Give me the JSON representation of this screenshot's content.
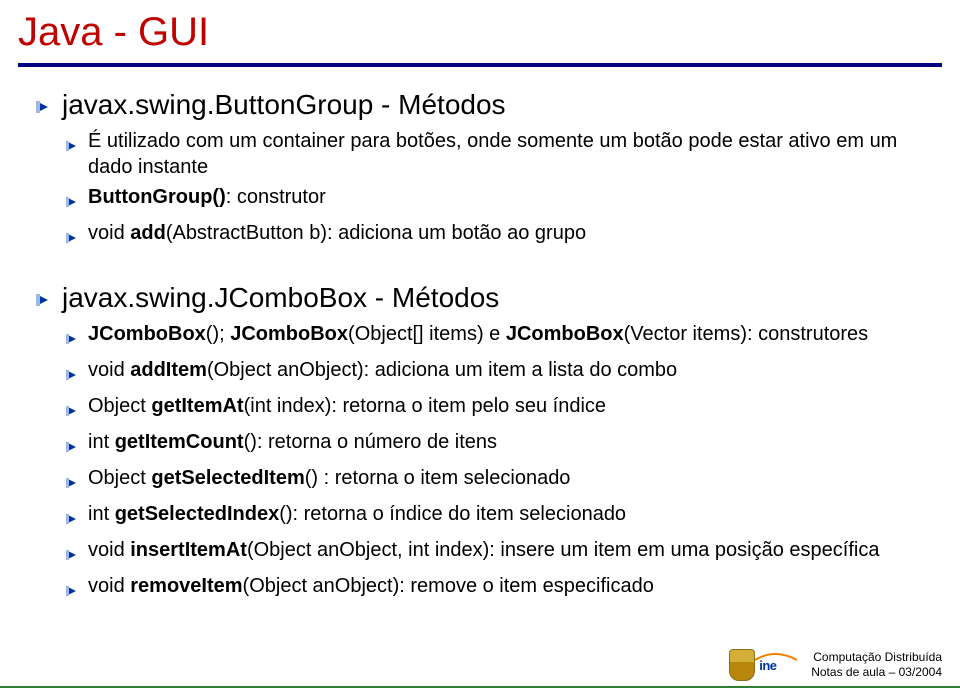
{
  "title": "Java - GUI",
  "section1": {
    "heading": "javax.swing.ButtonGroup - Métodos",
    "items": [
      {
        "text": "É utilizado com um container para botões, onde somente um botão pode estar ativo em um dado instante"
      },
      {
        "bold": "ButtonGroup()",
        "rest": ": construtor"
      },
      {
        "prefix": "void ",
        "bold": "add",
        "rest": "(AbstractButton b): adiciona um botão ao grupo"
      }
    ]
  },
  "section2": {
    "heading": "javax.swing.JComboBox - Métodos",
    "items": [
      {
        "bold": "JComboBox",
        "rest": "(); ",
        "bold2": "JComboBox",
        "rest2": "(Object[] items) e ",
        "bold3": "JComboBox",
        "rest3": "(Vector items): construtores"
      },
      {
        "prefix": "void ",
        "bold": "addItem",
        "rest": "(Object anObject): adiciona um item a lista do combo"
      },
      {
        "prefix": "Object ",
        "bold": "getItemAt",
        "rest": "(int index): retorna o item pelo seu índice"
      },
      {
        "prefix": "int ",
        "bold": "getItemCount",
        "rest": "(): retorna o número de itens"
      },
      {
        "prefix": "Object ",
        "bold": "getSelectedItem",
        "rest": "() : retorna o item selecionado"
      },
      {
        "prefix": " int ",
        "bold": "getSelectedIndex",
        "rest": "(): retorna o índice do item selecionado"
      },
      {
        "prefix": "void ",
        "bold": "insertItemAt",
        "rest": "(Object anObject, int index): insere um item em uma posição específica"
      },
      {
        "prefix": "void ",
        "bold": "removeItem",
        "rest": "(Object anObject): remove o item especificado"
      }
    ]
  },
  "footer": {
    "line1": "Computação Distribuída",
    "line2": "Notas de aula – 03/2004",
    "ine": "ine"
  }
}
